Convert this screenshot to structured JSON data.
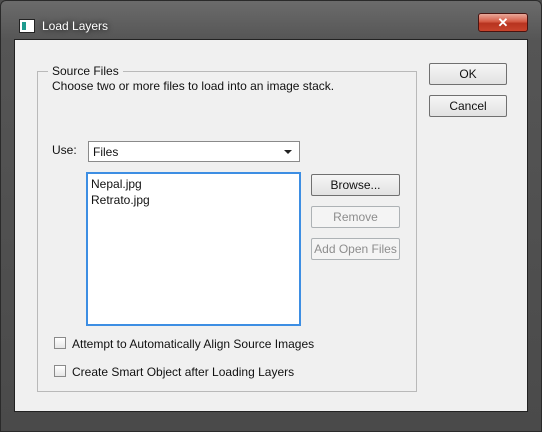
{
  "window": {
    "title": "Load Layers",
    "close_glyph": "✕",
    "icon": "photoshop-app-icon"
  },
  "source_files": {
    "legend": "Source Files",
    "description": "Choose two or more files to load into an image stack.",
    "use_label": "Use:",
    "use_selected": "Files",
    "files": [
      "Nepal.jpg",
      "Retrato.jpg"
    ]
  },
  "buttons": {
    "ok": "OK",
    "cancel": "Cancel",
    "browse": "Browse...",
    "remove": "Remove",
    "add_open_files": "Add Open Files"
  },
  "options": {
    "auto_align": {
      "label": "Attempt to Automatically Align Source Images",
      "checked": false
    },
    "smart_object": {
      "label": "Create Smart Object after Loading Layers",
      "checked": false
    }
  }
}
